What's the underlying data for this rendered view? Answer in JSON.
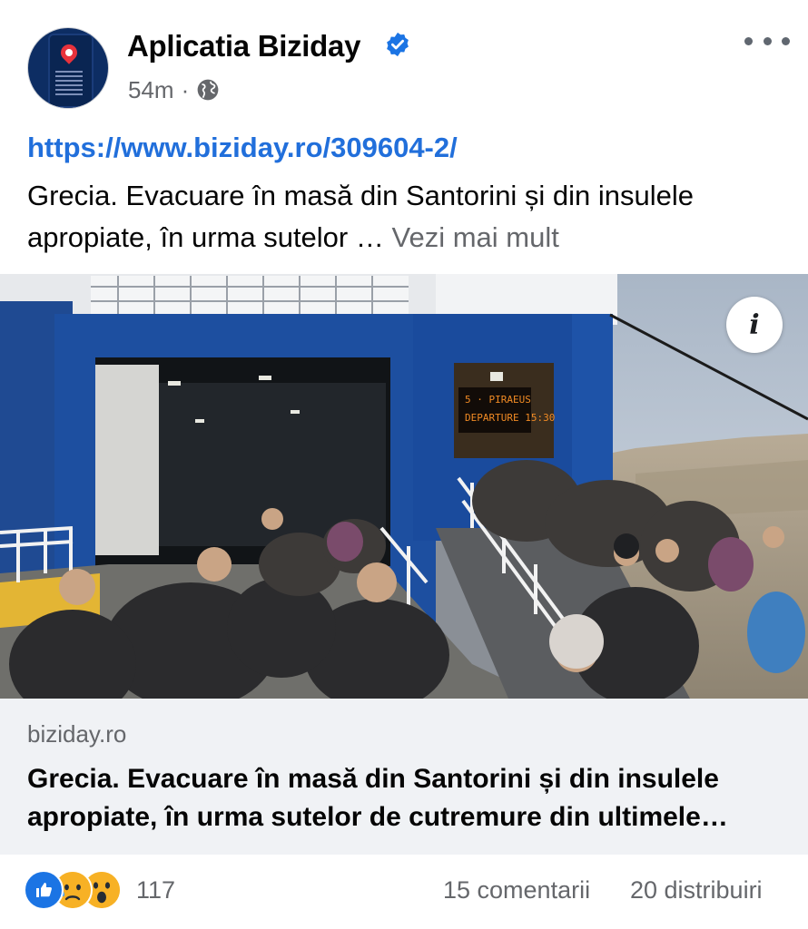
{
  "post": {
    "page_name": "Aplicatia Biziday",
    "time_ago": "54m",
    "separator": "·",
    "audience_icon": "globe-icon",
    "verified_icon": "verified-badge-icon",
    "more_icon": "more-options-icon",
    "link_url": "https://www.biziday.ro/309604-2/",
    "text": "Grecia. Evacuare în masă din Santorini și din insulele apropiate, în urma sutelor …",
    "see_more_label": "Vezi mai mult"
  },
  "photo": {
    "info_icon": "info-icon",
    "info_label": "i",
    "sign_line1": "5 · PIRAEUS",
    "sign_line2": "DEPARTURE 15:30"
  },
  "link_card": {
    "domain": "biziday.ro",
    "title": "Grecia. Evacuare în masă din Santorini și din insulele apropiate, în urma sutelor de cutremure din ultimele…"
  },
  "engagement": {
    "reaction_icons": [
      "like-icon",
      "sad-icon",
      "wow-icon"
    ],
    "reaction_count": "117",
    "comments": "15 comentarii",
    "shares": "20 distribuiri"
  },
  "colors": {
    "link": "#216fdb",
    "verified": "#1b74e4",
    "secondary_text": "#65676b",
    "card_background": "#f0f2f5"
  }
}
